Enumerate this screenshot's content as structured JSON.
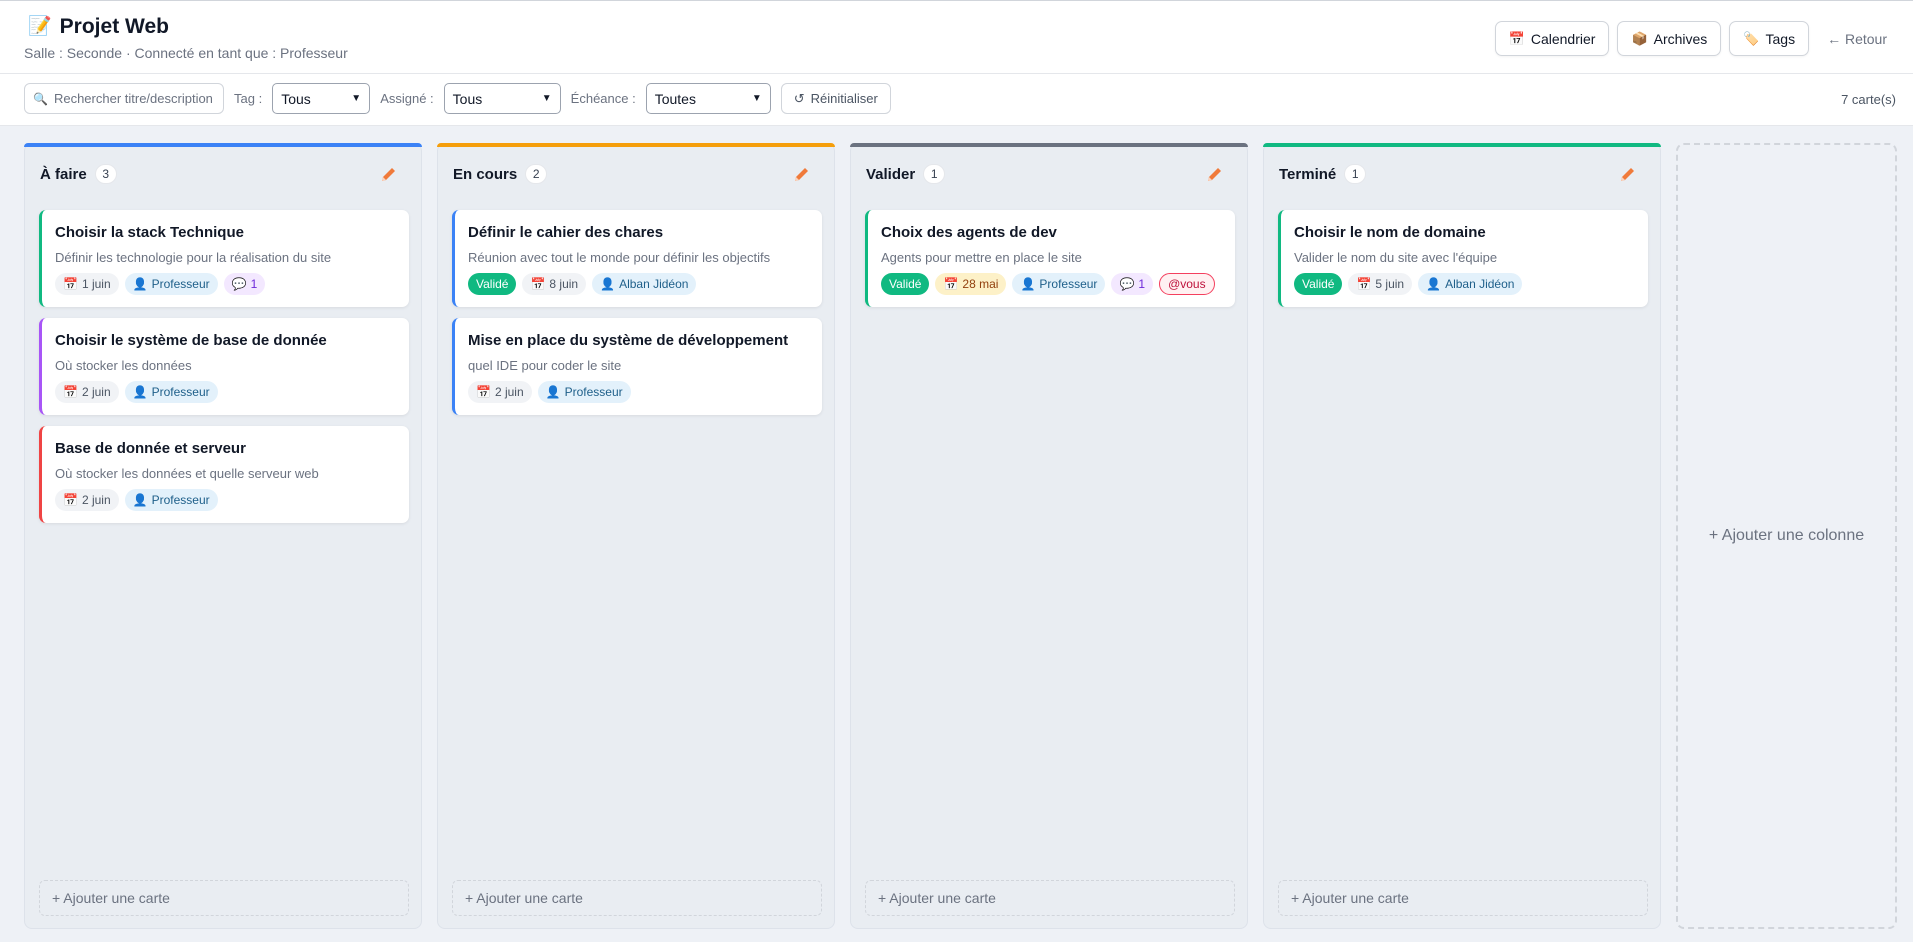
{
  "header": {
    "icon": "memo-icon",
    "title": "Projet Web",
    "subtitle": "Salle : Seconde · Connecté en tant que : Professeur",
    "buttons": {
      "calendar": "Calendrier",
      "archives": "Archives",
      "tags": "Tags"
    },
    "back_label": "← Retour"
  },
  "toolbar": {
    "search_placeholder": "Rechercher titre/description",
    "tag_label": "Tag :",
    "tag_value": "Tous",
    "assigned_label": "Assigné :",
    "assigned_value": "Tous",
    "due_label": "Échéance :",
    "due_value": "Toutes",
    "reset_label": "Réinitialiser",
    "count_label": "7 carte(s)"
  },
  "colors": {
    "todo": "#3b82f6",
    "in_progress": "#f59e0b",
    "validate": "#6b7280",
    "done": "#10b981",
    "accent_pencil": "#f07a3a"
  },
  "columns": [
    {
      "title": "À faire",
      "count": "3",
      "cards": [
        {
          "title": "Choisir la stack Technique",
          "description": "Définir les technologie pour la réalisation du site",
          "date": "1 juin",
          "user": "Professeur",
          "comments": "1"
        },
        {
          "title": "Choisir le système de base de donnée",
          "description": "Où stocker les données",
          "date": "2 juin",
          "user": "Professeur"
        },
        {
          "title": "Base de donnée et serveur",
          "description": "Où stocker les données et quelle serveur web",
          "date": "2 juin",
          "user": "Professeur"
        }
      ]
    },
    {
      "title": "En cours",
      "count": "2",
      "cards": [
        {
          "title": "Définir le cahier des chares",
          "description": "Réunion avec tout le monde pour définir les objectifs",
          "status": "Validé",
          "date": "8 juin",
          "user": "Alban Jidéon"
        },
        {
          "title": "Mise en place du système de développement",
          "description": "quel IDE pour coder le site",
          "date": "2 juin",
          "user": "Professeur"
        }
      ]
    },
    {
      "title": "Valider",
      "count": "1",
      "cards": [
        {
          "title": "Choix des agents de dev",
          "description": "Agents pour mettre en place le site",
          "status": "Validé",
          "date": "28 mai",
          "user": "Professeur",
          "comments": "1",
          "mention": "@vous"
        }
      ]
    },
    {
      "title": "Terminé",
      "count": "1",
      "cards": [
        {
          "title": "Choisir le nom de domaine",
          "description": "Valider le nom du site avec l'équipe",
          "status": "Validé",
          "date": "5 juin",
          "user": "Alban Jidéon"
        }
      ]
    }
  ],
  "add_card_label": "+ Ajouter une carte",
  "add_column_label": "+ Ajouter une colonne"
}
